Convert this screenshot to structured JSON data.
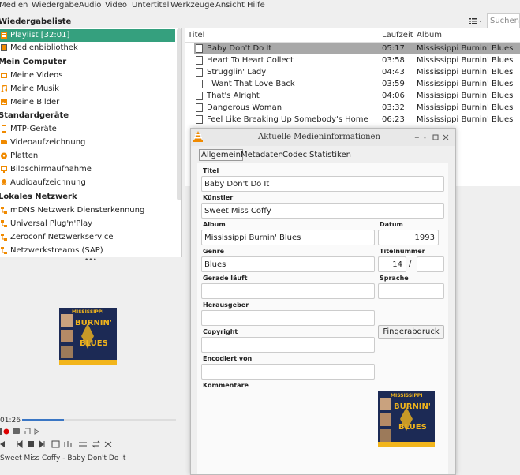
{
  "menu": [
    "Medien",
    "Wiedergabe",
    "Audio",
    "Video",
    "Untertitel",
    "Werkzeuge",
    "Ansicht",
    "Hilfe"
  ],
  "toolbar": {
    "search_placeholder": "Suchen"
  },
  "sidebar": {
    "header": "Wiedergabeliste",
    "items_top": [
      {
        "label": "Playlist [32:01]",
        "icon": "playlist-icon",
        "selected": true
      },
      {
        "label": "Medienbibliothek",
        "icon": "library-icon",
        "selected": false
      }
    ],
    "computer_header": "Mein Computer",
    "computer": [
      {
        "label": "Meine Videos",
        "icon": "video-folder-icon"
      },
      {
        "label": "Meine Musik",
        "icon": "music-folder-icon"
      },
      {
        "label": "Meine Bilder",
        "icon": "picture-folder-icon"
      }
    ],
    "devices_header": "Standardgeräte",
    "devices": [
      {
        "label": "MTP-Geräte",
        "icon": "mtp-device-icon"
      },
      {
        "label": "Videoaufzeichnung",
        "icon": "video-capture-icon"
      },
      {
        "label": "Platten",
        "icon": "disc-icon"
      },
      {
        "label": "Bildschirmaufnahme",
        "icon": "screen-capture-icon"
      },
      {
        "label": "Audioaufzeichnung",
        "icon": "audio-capture-icon"
      }
    ],
    "network_header": "Lokales Netzwerk",
    "network": [
      {
        "label": "mDNS Netzwerk Diensterkennung",
        "icon": "network-icon"
      },
      {
        "label": "Universal Plug'n'Play",
        "icon": "network-icon"
      },
      {
        "label": "Zeroconf Netzwerkservice",
        "icon": "network-icon"
      },
      {
        "label": "Netzwerkstreams (SAP)",
        "icon": "network-icon"
      }
    ]
  },
  "playlist": {
    "columns": [
      "Titel",
      "Laufzeit",
      "Album"
    ],
    "rows": [
      {
        "title": "Baby Don't Do It",
        "duration": "05:17",
        "album": "Mississippi Burnin' Blues",
        "selected": true
      },
      {
        "title": "Heart To Heart Collect",
        "duration": "03:58",
        "album": "Mississippi Burnin' Blues"
      },
      {
        "title": "Strugglin' Lady",
        "duration": "04:43",
        "album": "Mississippi Burnin' Blues"
      },
      {
        "title": "I Want That Love Back",
        "duration": "03:59",
        "album": "Mississippi Burnin' Blues"
      },
      {
        "title": "That's Alright",
        "duration": "04:06",
        "album": "Mississippi Burnin' Blues"
      },
      {
        "title": "Dangerous Woman",
        "duration": "03:32",
        "album": "Mississippi Burnin' Blues"
      },
      {
        "title": "Feel Like Breaking Up Somebody's Home",
        "duration": "06:23",
        "album": "Mississippi Burnin' Blues"
      }
    ]
  },
  "dialog": {
    "title": "Aktuelle Medieninformationen",
    "tabs": [
      "Allgemein",
      "Metadaten",
      "Codec",
      "Statistiken"
    ],
    "labels": {
      "title": "Titel",
      "artist": "Künstler",
      "album": "Album",
      "date": "Datum",
      "genre": "Genre",
      "track": "Titelnummer",
      "now_playing": "Gerade läuft",
      "language": "Sprache",
      "publisher": "Herausgeber",
      "copyright": "Copyright",
      "encoded_by": "Encodiert von",
      "comments": "Kommentare"
    },
    "values": {
      "title": "Baby Don't Do It",
      "artist": "Sweet Miss Coffy",
      "album": "Mississippi Burnin' Blues",
      "date": "1993",
      "genre": "Blues",
      "track": "14",
      "track_sep": "/"
    },
    "fingerprint_button": "Fingerabdruck"
  },
  "player": {
    "elapsed": "01:26",
    "progress": 0.27,
    "status": "Sweet Miss Coffy - Baby Don't Do It"
  },
  "cover_art": {
    "line1": "MISSISSIPPI",
    "line2": "BURNIN'",
    "line3": "BLUES"
  },
  "colors": {
    "selection": "#35a07e",
    "seek": "#3a76c4",
    "vlc_orange": "#f08a00"
  }
}
